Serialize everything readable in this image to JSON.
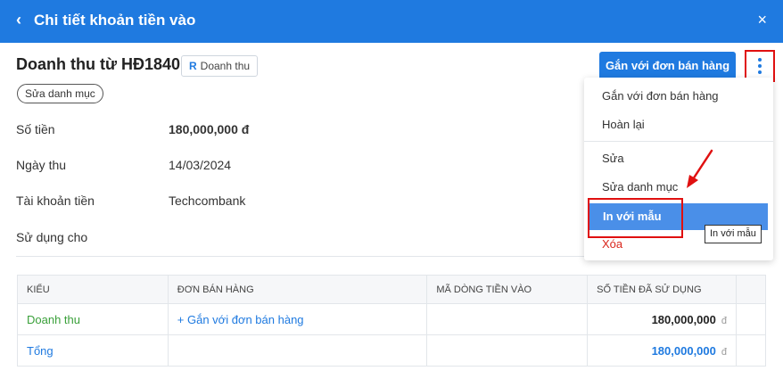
{
  "header": {
    "back_icon": "‹",
    "title": "Chi tiết khoản tiền vào",
    "close_icon": "×"
  },
  "doc": {
    "title": "Doanh thu từ HĐ1840",
    "tag": {
      "letter": "R",
      "label": "Doanh thu"
    },
    "edit_category_chip": "Sửa danh mục",
    "link_button": "Gắn với đơn bán hàng"
  },
  "details": [
    {
      "label": "Số tiền",
      "value": "180,000,000 đ"
    },
    {
      "label": "Ngày thu",
      "value": "14/03/2024"
    },
    {
      "label": "Tài khoản tiền",
      "value": "Techcombank"
    },
    {
      "label": "Sử dụng cho",
      "value": ""
    }
  ],
  "table": {
    "headers": [
      "KIỂU",
      "ĐƠN BÁN HÀNG",
      "MÃ DÒNG TIỀN VÀO",
      "SỐ TIỀN ĐÃ SỬ DỤNG"
    ],
    "rows": [
      {
        "type": "Doanh thu",
        "order_link": "+ Gắn với đơn bán hàng",
        "code": "",
        "amount": "180,000,000",
        "currency": "đ"
      }
    ],
    "total": {
      "label": "Tổng",
      "amount": "180,000,000",
      "currency": "đ"
    }
  },
  "menu": {
    "items": [
      "Gắn với đơn bán hàng",
      "Hoàn lại",
      "Sửa",
      "Sửa danh mục",
      "In với mẫu",
      "Xóa"
    ],
    "active_index": 4
  },
  "tooltip": "In với mẫu",
  "colors": {
    "primary": "#1f7ae0",
    "danger": "#d9261c",
    "success": "#3aa03a",
    "annotation": "#e01010"
  }
}
